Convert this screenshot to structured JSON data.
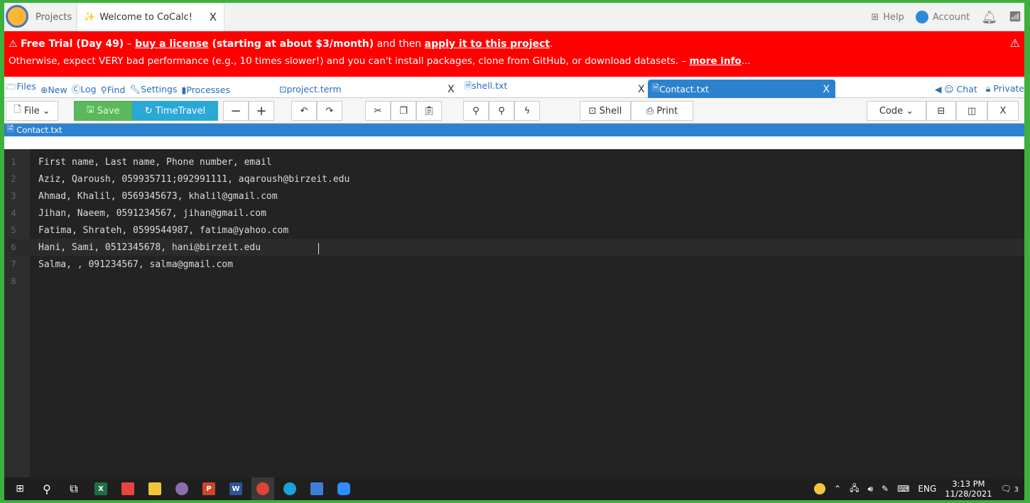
{
  "browser": {
    "projects_tab": "Projects",
    "welcome_tab": "Welcome to CoCalc!",
    "close_glyph": "X",
    "help": "Help",
    "account": "Account"
  },
  "banner": {
    "warn": "⚠",
    "trial": "Free Trial (Day 49)",
    "dash": " – ",
    "buy": "buy a license",
    "price": " (starting at about $3/month)",
    "and_then": " and then ",
    "apply": "apply it to this project",
    "period": ".",
    "line2_pre": "Otherwise, expect VERY bad performance (e.g., 10 times slower!) and you can't install packages, clone from GitHub, or download datasets. – ",
    "more": "more info",
    "ellipsis": "..."
  },
  "projnav": {
    "files": "Files",
    "new": "New",
    "log": "Log",
    "find": "Find",
    "settings": "Settings",
    "processes": "Processes",
    "tabs": [
      "project.term",
      "shell.txt",
      "Contact.txt"
    ],
    "chat": "Chat",
    "private": "Private"
  },
  "toolbar": {
    "file": "File",
    "save": "Save",
    "timetravel": "TimeTravel",
    "shell": "Shell",
    "print": "Print",
    "code": "Code"
  },
  "pathbar": {
    "filename": "Contact.txt"
  },
  "editor": {
    "lines": [
      "First name, Last name, Phone number, email",
      "Aziz, Qaroush, 059935711;092991111, aqaroush@birzeit.edu",
      "Ahmad, Khalil, 0569345673, khalil@gmail.com",
      "Jihan, Naeem, 0591234567, jihan@gmail.com",
      "Fatima, Shrateh, 0599544987, fatima@yahoo.com",
      "Hani, Sami, 0512345678, hani@birzeit.edu",
      "Salma, , 091234567, salma@gmail.com",
      ""
    ],
    "line_numbers": [
      "1",
      "2",
      "3",
      "4",
      "5",
      "6",
      "7",
      "8"
    ]
  },
  "taskbar": {
    "lang": "ENG",
    "time": "3:13 PM",
    "date": "11/28/2021",
    "notif_count": "3"
  },
  "colors": {
    "banner_bg": "#ff0000",
    "active_tab": "#2d82d0",
    "save_btn": "#5cb85c",
    "timetravel_btn": "#2aa8d6",
    "editor_bg": "#232323",
    "border_green": "#3db03d"
  }
}
